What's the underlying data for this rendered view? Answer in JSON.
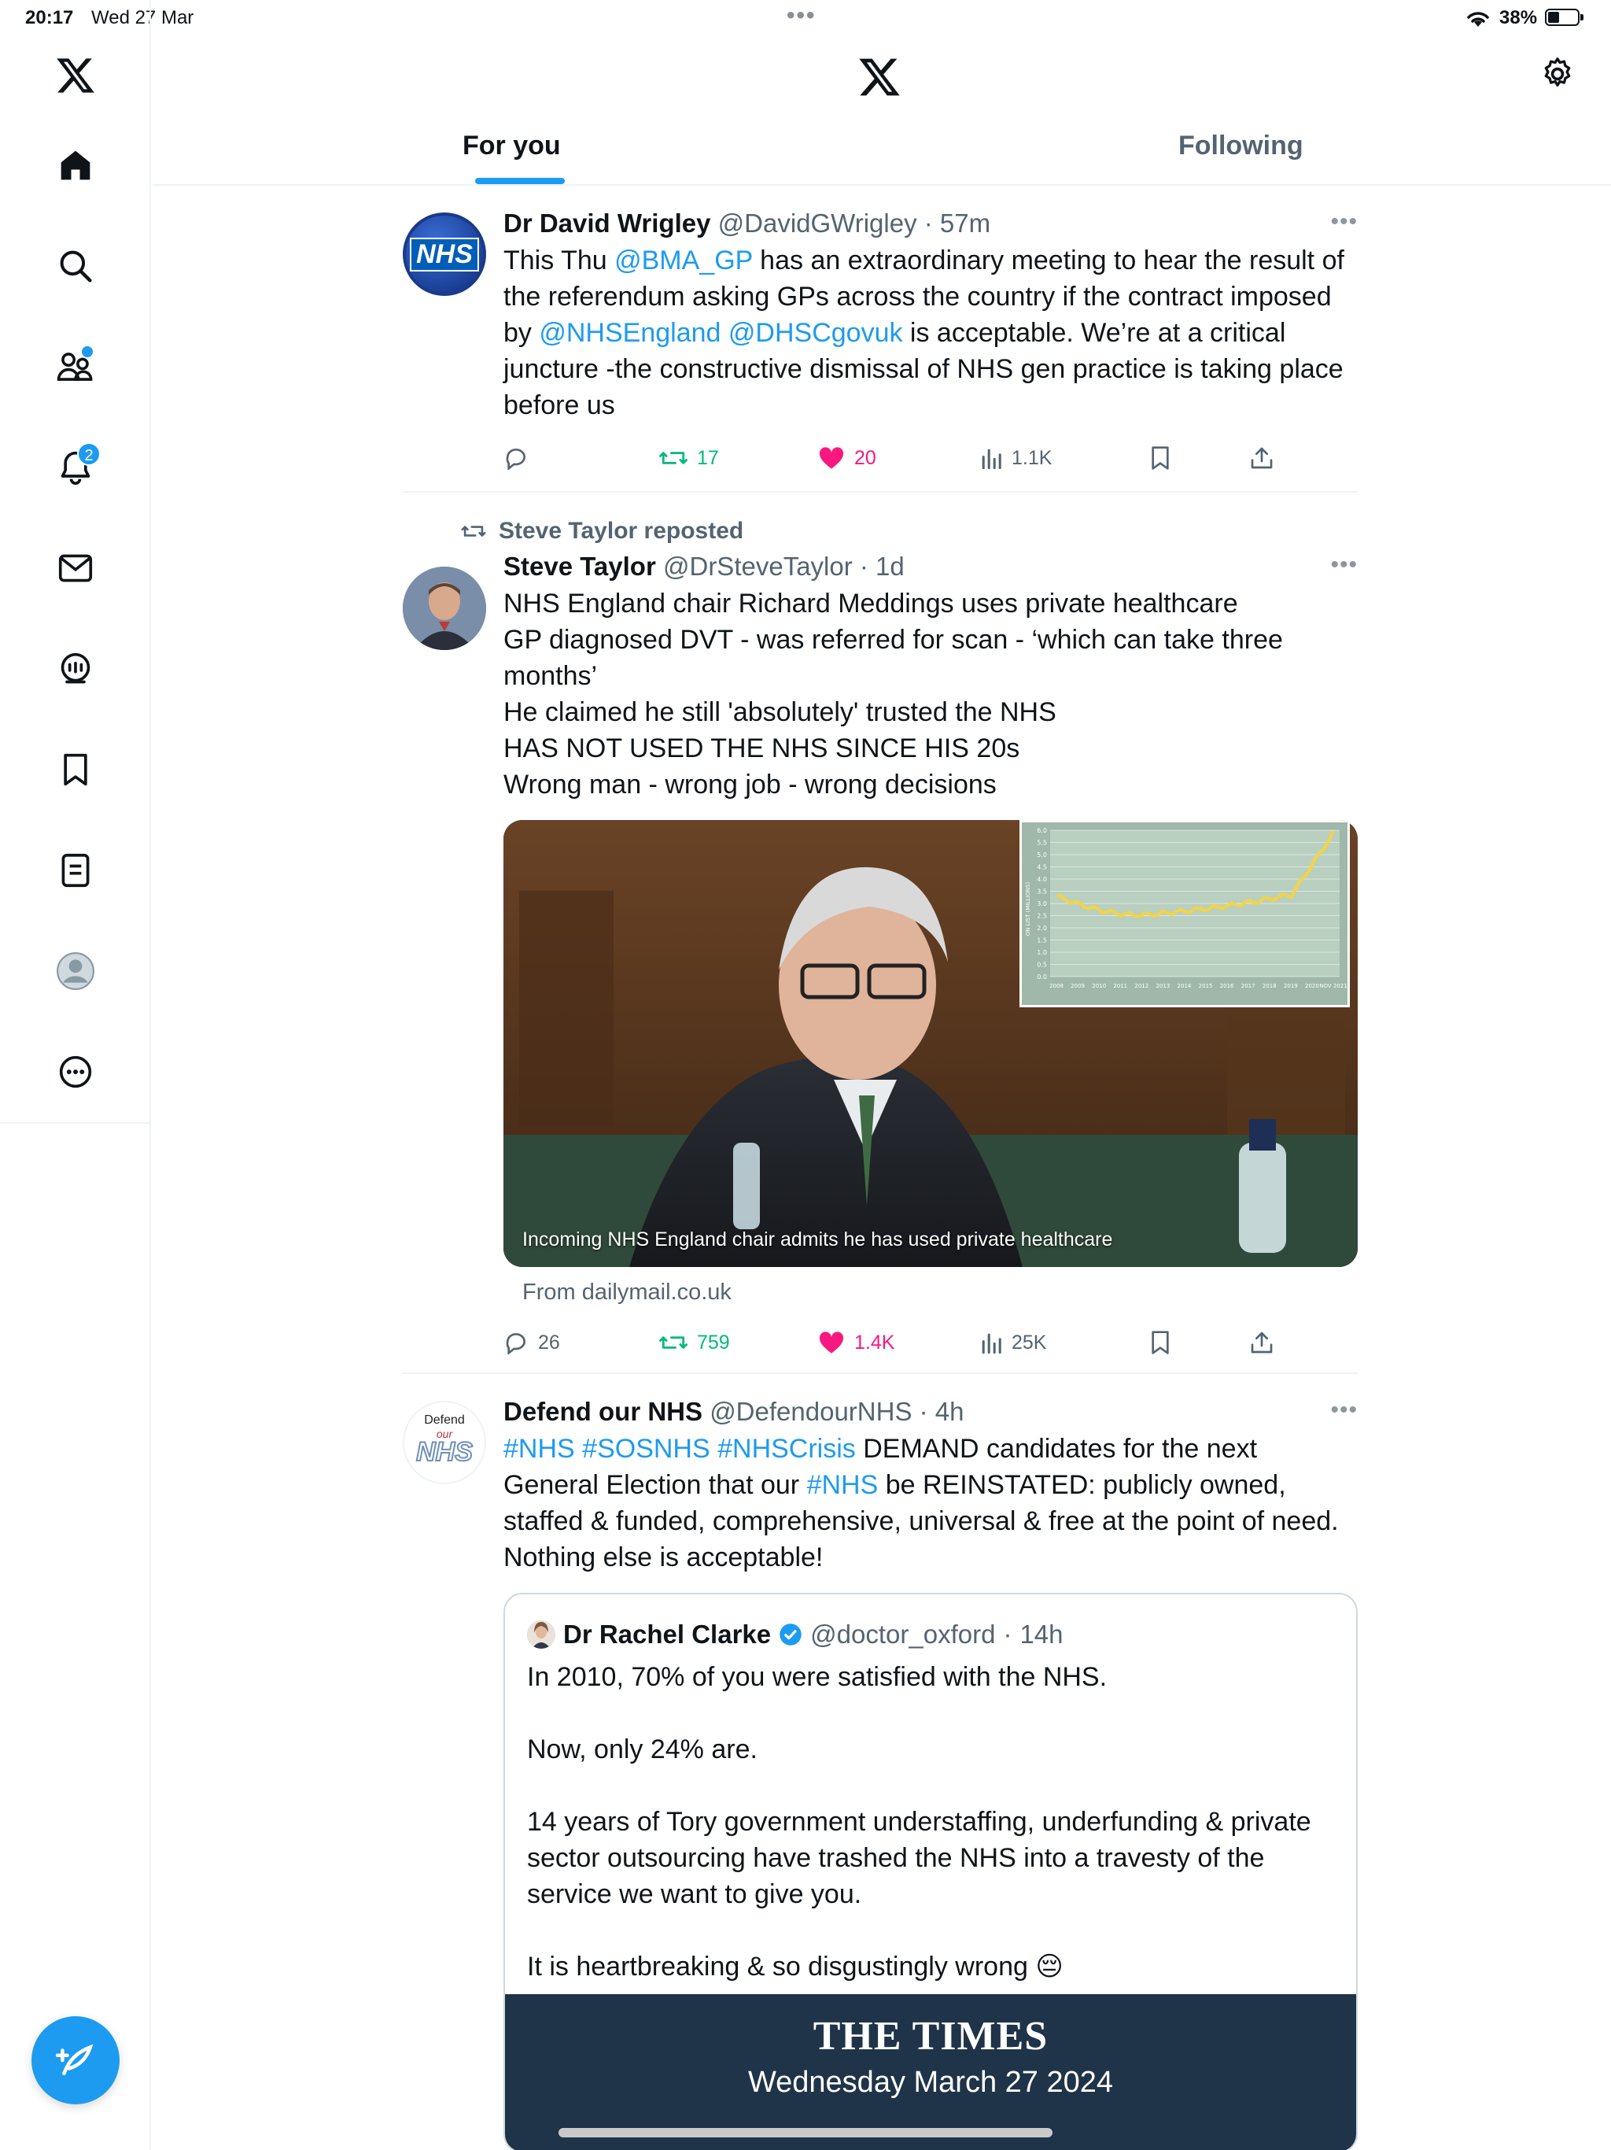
{
  "status_bar": {
    "time": "20:17",
    "date": "Wed 27 Mar",
    "battery_pct": "38%",
    "battery_level": 0.38
  },
  "header": {
    "logo_icon": "x-logo-icon",
    "settings_icon": "gear-icon",
    "tabs": [
      {
        "label": "For you",
        "active": true
      },
      {
        "label": "Following",
        "active": false
      }
    ]
  },
  "sidebar": {
    "items": [
      {
        "name": "x-logo-icon"
      },
      {
        "name": "home-icon"
      },
      {
        "name": "search-icon"
      },
      {
        "name": "communities-icon"
      },
      {
        "name": "notifications-icon",
        "badge": "2"
      },
      {
        "name": "messages-icon"
      },
      {
        "name": "grok-icon"
      },
      {
        "name": "bookmarks-icon"
      },
      {
        "name": "lists-icon"
      },
      {
        "name": "profile-icon"
      },
      {
        "name": "more-icon"
      }
    ],
    "compose_icon": "compose-icon"
  },
  "colors": {
    "accent": "#1d9bf0",
    "retweet": "#00ba7c",
    "like": "#f91880",
    "muted": "#536471"
  },
  "posts": [
    {
      "name": "Dr David Wrigley",
      "handle": "@DavidGWrigley",
      "time": "57m",
      "avatar_text": "NHS",
      "text_parts": [
        {
          "t": "This Thu "
        },
        {
          "t": "@BMA_GP",
          "link": true
        },
        {
          "t": " has an extraordinary meeting to hear the result of the referendum asking GPs across the country if the contract imposed by "
        },
        {
          "t": "@NHSEngland",
          "link": true
        },
        {
          "t": " "
        },
        {
          "t": "@DHSCgovuk",
          "link": true
        },
        {
          "t": " is acceptable. We’re at a critical juncture -the constructive dismissal of NHS gen practice is taking place before us"
        }
      ],
      "replies": "",
      "reposts": "17",
      "likes": "20",
      "views": "1.1K"
    },
    {
      "repost_label": "Steve Taylor reposted",
      "name": "Steve Taylor",
      "handle": "@DrSteveTaylor",
      "time": "1d",
      "text": "NHS England chair Richard Meddings uses private healthcare\nGP diagnosed DVT - was referred for scan - ‘which can take three months’\nHe claimed he still 'absolutely' trusted the NHS\nHAS NOT USED THE NHS SINCE HIS 20s\nWrong man - wrong job - wrong decisions",
      "media_caption": "Incoming NHS England chair admits he has used private healthcare",
      "from": "From dailymail.co.uk",
      "inset_chart": {
        "x_labels": [
          "2008",
          "2009",
          "2010",
          "2011",
          "2012",
          "2013",
          "2014",
          "2015",
          "2016",
          "2017",
          "2018",
          "2019",
          "2020",
          "NOV 2021"
        ],
        "y_labels": [
          "0.0",
          "0.5",
          "1.0",
          "1.5",
          "2.0",
          "2.5",
          "3.0",
          "3.5",
          "4.0",
          "4.5",
          "5.0",
          "5.5",
          "6.0"
        ],
        "y_title": "ON LIST (MILLIONS)"
      },
      "replies": "26",
      "reposts": "759",
      "likes": "1.4K",
      "views": "25K"
    },
    {
      "name": "Defend our NHS",
      "handle": "@DefendourNHS",
      "time": "4h",
      "avatar_lines": [
        "Defend",
        "our",
        "NHS"
      ],
      "text_parts": [
        {
          "t": "#NHS",
          "link": true
        },
        {
          "t": " "
        },
        {
          "t": "#SOSNHS",
          "link": true
        },
        {
          "t": " "
        },
        {
          "t": "#NHSCrisis",
          "link": true
        },
        {
          "t": " DEMAND candidates for the next General Election that our "
        },
        {
          "t": "#NHS",
          "link": true
        },
        {
          "t": " be REINSTATED: publicly owned, staffed & funded, comprehensive, universal & free at the point of need. Nothing else is acceptable!"
        }
      ],
      "quote": {
        "name": "Dr Rachel Clarke",
        "handle": "@doctor_oxford",
        "time": "14h",
        "text": "In 2010, 70% of you were satisfied with the NHS.\n\nNow, only 24% are.\n\n14 years of Tory government understaffing, underfunding & private sector outsourcing have trashed the NHS into a travesty of the service we want to give you.\n\nIt is heartbreaking & so disgustingly wrong 😔",
        "media_masthead": "THE TIMES",
        "media_date": "Wednesday March 27 2024"
      }
    }
  ]
}
